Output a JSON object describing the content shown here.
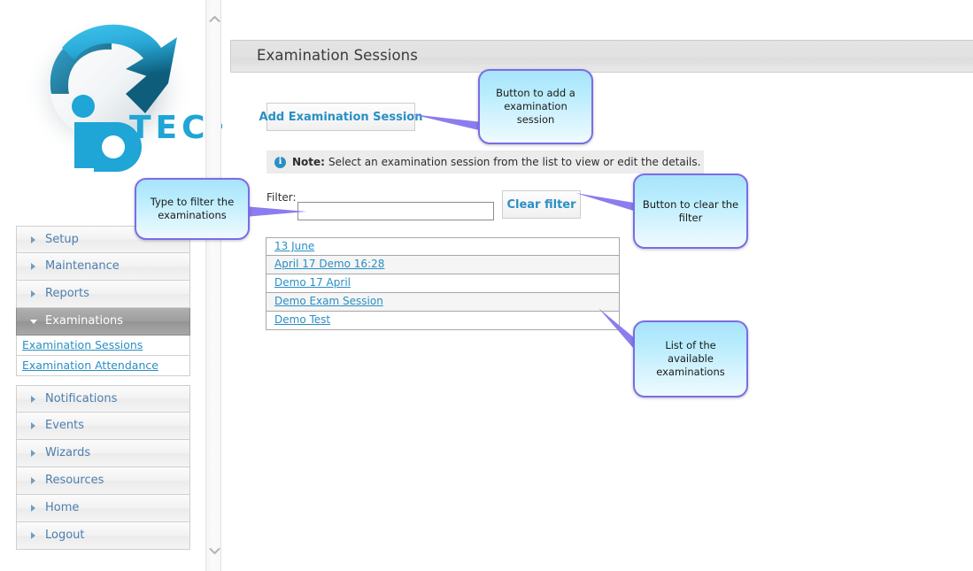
{
  "brand": {
    "logo_text": "TECH",
    "logo_mark": "ip-recycle-arrow-logo"
  },
  "sidebar": {
    "items": [
      {
        "label": "Setup",
        "state": "collapsed",
        "icon": "chevron-right-icon"
      },
      {
        "label": "Maintenance",
        "state": "collapsed",
        "icon": "chevron-right-icon"
      },
      {
        "label": "Reports",
        "state": "collapsed",
        "icon": "chevron-right-icon"
      },
      {
        "label": "Examinations",
        "state": "expanded",
        "icon": "chevron-down-icon"
      }
    ],
    "sub_items": [
      {
        "label": "Examination Sessions"
      },
      {
        "label": "Examination Attendance"
      }
    ],
    "items_after": [
      {
        "label": "Notifications",
        "state": "collapsed",
        "icon": "chevron-right-icon"
      },
      {
        "label": "Events",
        "state": "collapsed",
        "icon": "chevron-right-icon"
      },
      {
        "label": "Wizards",
        "state": "collapsed",
        "icon": "chevron-right-icon"
      },
      {
        "label": "Resources",
        "state": "collapsed",
        "icon": "chevron-right-icon"
      },
      {
        "label": "Home",
        "state": "collapsed",
        "icon": "chevron-right-icon"
      },
      {
        "label": "Logout",
        "state": "collapsed",
        "icon": "chevron-right-icon"
      }
    ]
  },
  "scrollbar": {
    "up_icon": "chevron-up-icon",
    "down_icon": "chevron-down-icon"
  },
  "main": {
    "page_title": "Examination Sessions",
    "add_button_label": "Add Examination Session",
    "note": {
      "icon": "info-icon",
      "bold_prefix": "Note:",
      "text": "Select an examination session from the list to view or edit the details."
    },
    "filter": {
      "label": "Filter:",
      "value": "",
      "placeholder": "",
      "clear_button_label": "Clear filter"
    },
    "sessions": [
      {
        "label": "13 June"
      },
      {
        "label": "April 17 Demo 16:28"
      },
      {
        "label": "Demo 17 April"
      },
      {
        "label": "Demo Exam Session"
      },
      {
        "label": "Demo Test"
      }
    ]
  },
  "callouts": [
    {
      "id": "add",
      "text": "Button to add a examination session"
    },
    {
      "id": "filter",
      "text": "Type to filter the examinations"
    },
    {
      "id": "clear",
      "text": "Button to clear the filter"
    },
    {
      "id": "list",
      "text": "List of the available examinations"
    }
  ],
  "colors": {
    "link": "#2a8fc4",
    "callout_border": "#7b6ce8",
    "callout_fill": "#b7ecfd",
    "active_nav": "#9e9e9e",
    "brand_blue": "#1fa5d6"
  }
}
